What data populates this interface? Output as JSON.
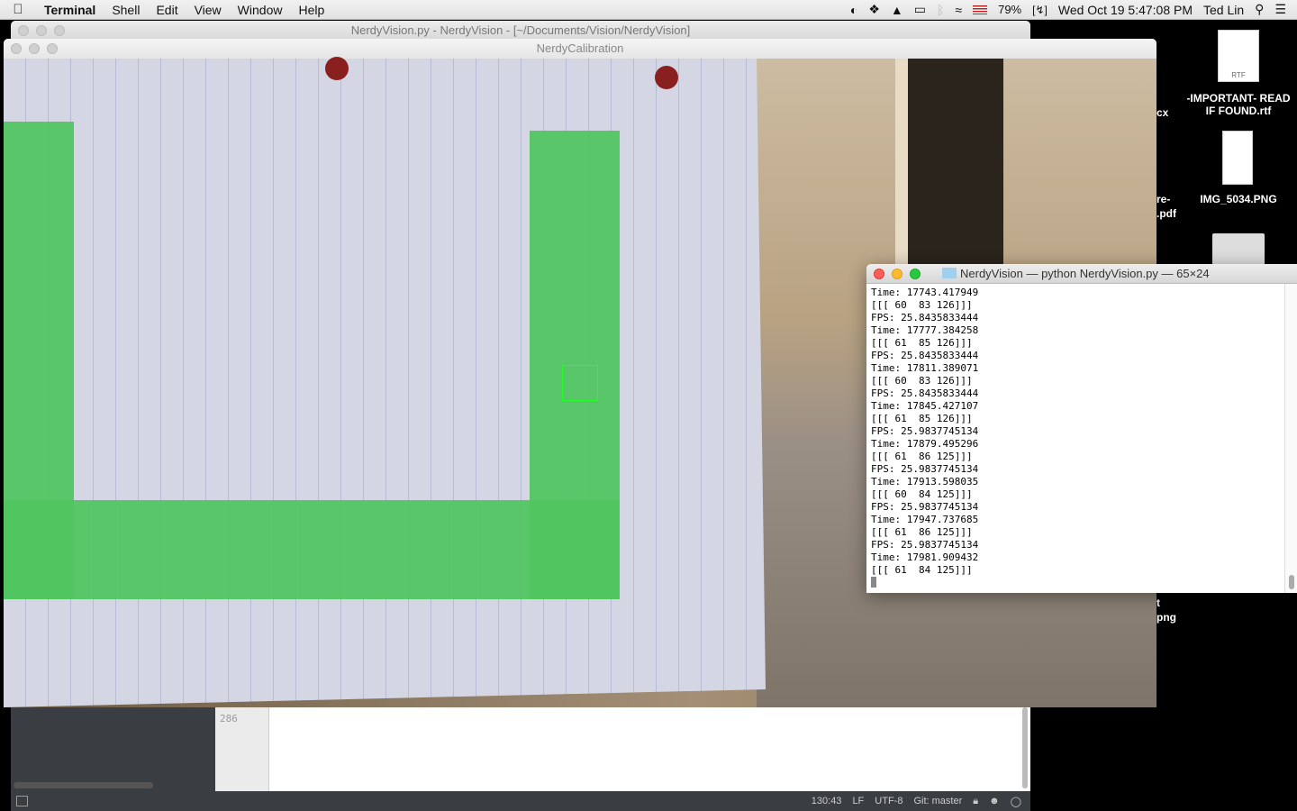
{
  "menubar": {
    "app": "Terminal",
    "items": [
      "Shell",
      "Edit",
      "View",
      "Window",
      "Help"
    ],
    "battery": "79%",
    "datetime": "Wed Oct 19  5:47:08 PM",
    "user": "Ted Lin"
  },
  "desktop": {
    "icons": [
      {
        "label": "-IMPORTANT- READ IF FOUND.rtf",
        "badge": "RTF"
      },
      {
        "label": "IMG_5034.PNG"
      }
    ],
    "partial_labels": [
      "cx",
      "re-",
      ".pdf",
      "t",
      "png"
    ]
  },
  "editor": {
    "title": "NerdyVision.py - NerdyVision - [~/Documents/Vision/NerdyVision]",
    "line_number": "286",
    "status": {
      "cursor": "130:43",
      "line_ending": "LF",
      "encoding": "UTF-8",
      "git": "Git: master"
    }
  },
  "calibration": {
    "title": "NerdyCalibration"
  },
  "terminal": {
    "title": "NerdyVision — python NerdyVision.py — 65×24",
    "lines": [
      "Time: 17743.417949",
      "[[[ 60  83 126]]]",
      "FPS: 25.8435833444",
      "Time: 17777.384258",
      "[[[ 61  85 126]]]",
      "FPS: 25.8435833444",
      "Time: 17811.389071",
      "[[[ 60  83 126]]]",
      "FPS: 25.8435833444",
      "Time: 17845.427107",
      "[[[ 61  85 126]]]",
      "FPS: 25.9837745134",
      "Time: 17879.495296",
      "[[[ 61  86 125]]]",
      "FPS: 25.9837745134",
      "Time: 17913.598035",
      "[[[ 60  84 125]]]",
      "FPS: 25.9837745134",
      "Time: 17947.737685",
      "[[[ 61  86 125]]]",
      "FPS: 25.9837745134",
      "Time: 17981.909432",
      "[[[ 61  84 125]]]"
    ]
  }
}
